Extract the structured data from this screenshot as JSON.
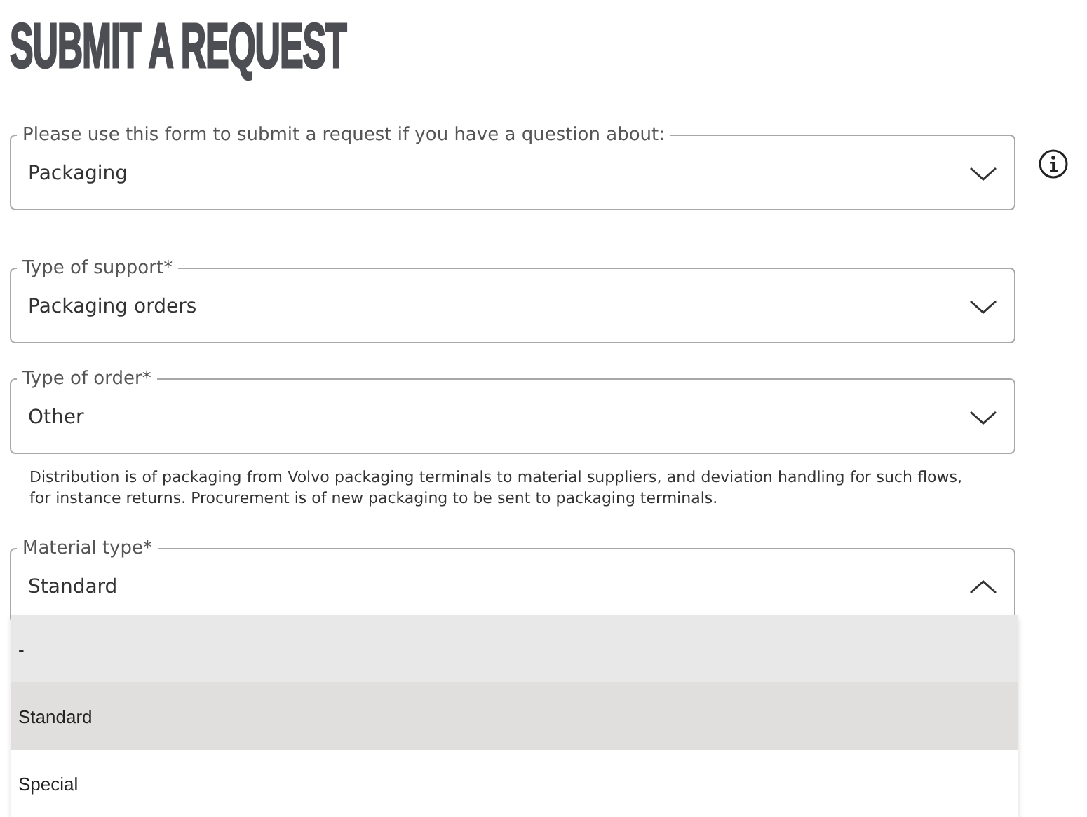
{
  "title": "SUBMIT A REQUEST",
  "fields": [
    {
      "label": "Please use this form to submit a request if you have a question about:",
      "value": "Packaging",
      "expanded": false,
      "info_button": true
    },
    {
      "label": "Type of support*",
      "value": "Packaging orders",
      "expanded": false
    },
    {
      "label": "Type of order*",
      "value": "Other",
      "expanded": false,
      "help": "Distribution is of packaging from Volvo packaging terminals to material suppliers, and deviation handling for such flows, for instance returns. Procurement is of new packaging to be sent to packaging terminals."
    },
    {
      "label": "Material type*",
      "value": "Standard",
      "expanded": true,
      "options": [
        {
          "label": "-",
          "selected": false,
          "hovered": true
        },
        {
          "label": "Standard",
          "selected": true,
          "hovered": false
        },
        {
          "label": "Special",
          "selected": false,
          "hovered": false
        }
      ]
    }
  ]
}
